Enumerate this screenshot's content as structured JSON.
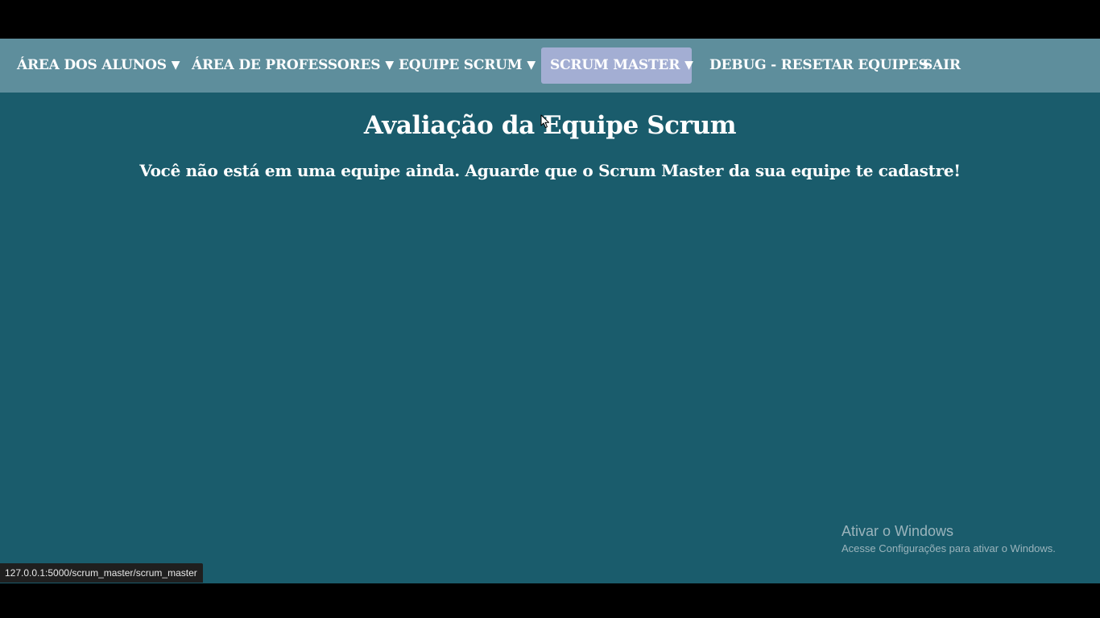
{
  "nav": {
    "items": [
      {
        "label": "ÁREA DOS ALUNOS",
        "caret": "▼"
      },
      {
        "label": "ÁREA DE PROFESSORES",
        "caret": "▼"
      },
      {
        "label": "EQUIPE SCRUM",
        "caret": "▼"
      },
      {
        "label": "SCRUM MASTER",
        "caret": "▼"
      },
      {
        "label": "DEBUG - RESETAR EQUIPES"
      },
      {
        "label": "SAIR"
      }
    ],
    "active_item": "SCRUM MASTER"
  },
  "main": {
    "title": "Avaliação da Equipe Scrum",
    "message": "Você não está em uma equipe ainda. Aguarde que o Scrum Master da sua equipe te cadastre!"
  },
  "watermark": {
    "title": "Ativar o Windows",
    "subtitle": "Acesse Configurações para ativar o Windows."
  },
  "status_bar": {
    "url": "127.0.0.1:5000/scrum_master/scrum_master"
  },
  "colors": {
    "background": "#1a5c6c",
    "navbar": "#5e8e9c",
    "active_item": "#a3aed3",
    "text": "#ffffff"
  },
  "icons": {
    "caret": "caret-down-icon",
    "cursor": "mouse-pointer-icon"
  }
}
